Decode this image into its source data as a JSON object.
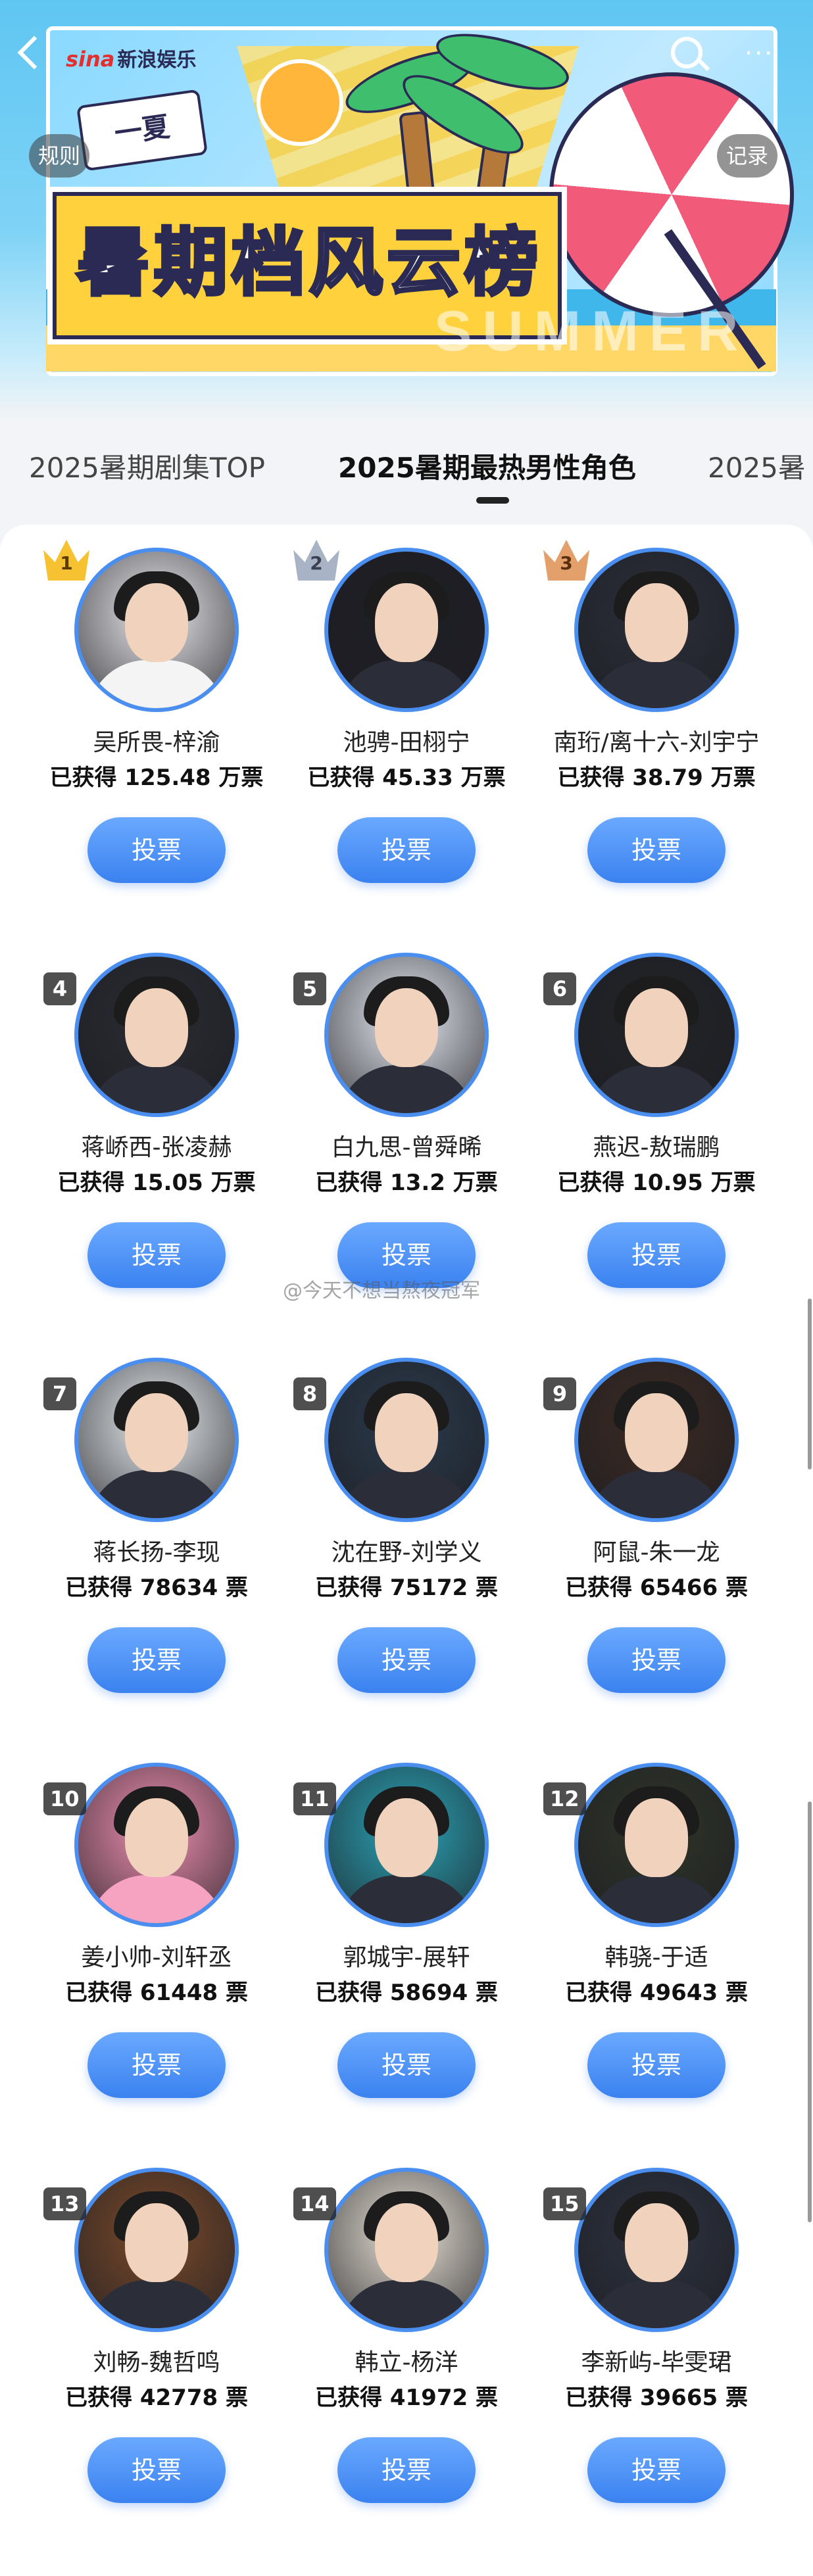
{
  "header": {
    "logo_sina": "sina",
    "logo_text": "新浪娱乐",
    "badge_text": "一夏",
    "title": "暑期档风云榜",
    "summer_word": "SUMMER",
    "rules_label": "规则",
    "record_label": "记录"
  },
  "tabs": [
    {
      "label": "2025暑期剧集TOP"
    },
    {
      "label": "2025暑期最热男性角色"
    },
    {
      "label": "2025暑"
    }
  ],
  "vote_label": "投票",
  "watermark": "@今天不想当熬夜冠军",
  "candidates": [
    {
      "rank": "1",
      "name": "吴所畏-梓渝",
      "votes": "已获得 125.48 万票",
      "tone": "#e9e9ee"
    },
    {
      "rank": "2",
      "name": "池骋-田栩宁",
      "votes": "已获得 45.33 万票",
      "tone": "#1e1e26"
    },
    {
      "rank": "3",
      "name": "南珩/离十六-刘宇宁",
      "votes": "已获得 38.79 万票",
      "tone": "#2b2f3a"
    },
    {
      "rank": "4",
      "name": "蒋峤西-张凌赫",
      "votes": "已获得 15.05 万票",
      "tone": "#2a2c33"
    },
    {
      "rank": "5",
      "name": "白九思-曾舜晞",
      "votes": "已获得 13.2 万票",
      "tone": "#e6eaf2"
    },
    {
      "rank": "6",
      "name": "燕迟-敖瑞鹏",
      "votes": "已获得 10.95 万票",
      "tone": "#222428"
    },
    {
      "rank": "7",
      "name": "蒋长扬-李现",
      "votes": "已获得 78634 票",
      "tone": "#e7ecef"
    },
    {
      "rank": "8",
      "name": "沈在野-刘学义",
      "votes": "已获得 75172 票",
      "tone": "#2a3a4c"
    },
    {
      "rank": "9",
      "name": "阿鼠-朱一龙",
      "votes": "已获得 65466 票",
      "tone": "#3b2a22"
    },
    {
      "rank": "10",
      "name": "姜小帅-刘轩丞",
      "votes": "已获得 61448 票",
      "tone": "#f08fb0"
    },
    {
      "rank": "11",
      "name": "郭城宇-展轩",
      "votes": "已获得 58694 票",
      "tone": "#2aa3b6"
    },
    {
      "rank": "12",
      "name": "韩骁-于适",
      "votes": "已获得 49643 票",
      "tone": "#2f3528"
    },
    {
      "rank": "13",
      "name": "刘畅-魏哲鸣",
      "votes": "已获得 42778 票",
      "tone": "#7a4a2a"
    },
    {
      "rank": "14",
      "name": "韩立-杨洋",
      "votes": "已获得 41972 票",
      "tone": "#e9e2d6"
    },
    {
      "rank": "15",
      "name": "李新屿-毕雯珺",
      "votes": "已获得 39665 票",
      "tone": "#2d3340"
    }
  ],
  "colors": {
    "accent": "#3b82f0",
    "gold": "#f6c232",
    "silver": "#a8b4c6",
    "bronze": "#e3a06a"
  }
}
